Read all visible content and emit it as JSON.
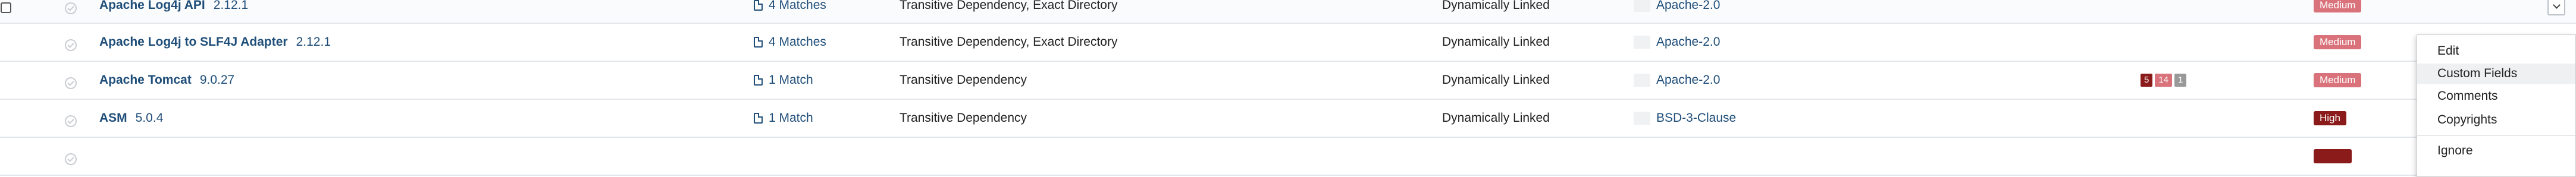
{
  "rows": [
    {
      "name": "Apache Log4j API",
      "version": "2.12.1",
      "matches": "4 Matches",
      "dependency": "Transitive Dependency, Exact Directory",
      "linking": "Dynamically Linked",
      "license": "Apache-2.0",
      "severity": "Medium",
      "counts": null
    },
    {
      "name": "Apache Log4j to SLF4J Adapter",
      "version": "2.12.1",
      "matches": "4 Matches",
      "dependency": "Transitive Dependency, Exact Directory",
      "linking": "Dynamically Linked",
      "license": "Apache-2.0",
      "severity": "Medium",
      "counts": null
    },
    {
      "name": "Apache Tomcat",
      "version": "9.0.27",
      "matches": "1 Match",
      "dependency": "Transitive Dependency",
      "linking": "Dynamically Linked",
      "license": "Apache-2.0",
      "severity": "Medium",
      "counts": {
        "high": "5",
        "medium": "14",
        "low": "1"
      }
    },
    {
      "name": "ASM",
      "version": "5.0.4",
      "matches": "1 Match",
      "dependency": "Transitive Dependency",
      "linking": "Dynamically Linked",
      "license": "BSD-3-Clause",
      "severity": "High",
      "counts": null
    }
  ],
  "menu": {
    "edit": "Edit",
    "custom_fields": "Custom Fields",
    "comments": "Comments",
    "copyrights": "Copyrights",
    "ignore": "Ignore"
  },
  "colors": {
    "link": "#1f4e79",
    "medium": "#d9727a",
    "high": "#8b1a1a"
  },
  "icons": {
    "matches": "file-icon",
    "status": "check-circle-icon",
    "row_action": "chevron-down-icon"
  }
}
